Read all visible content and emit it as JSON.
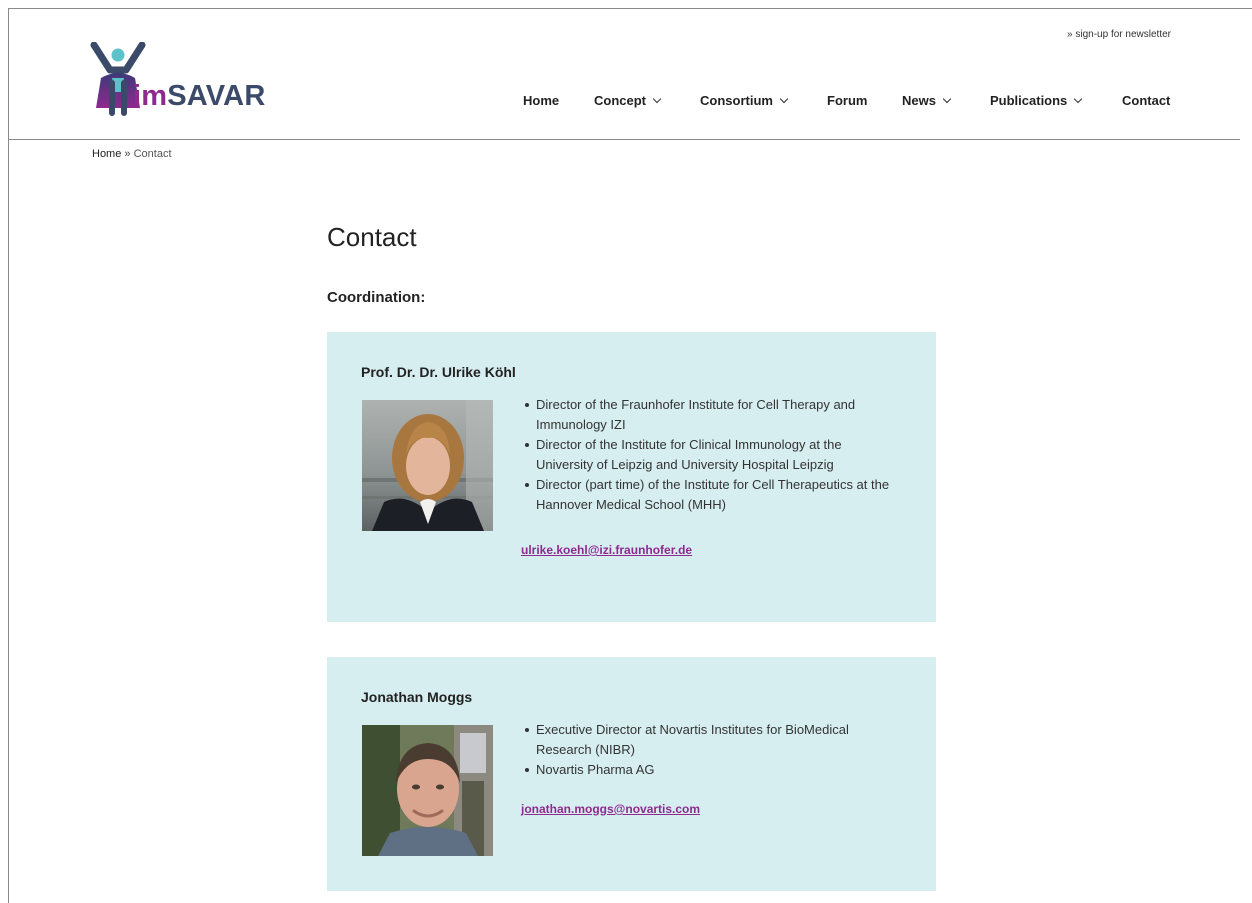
{
  "header": {
    "newsletter_link": "» sign-up for newsletter",
    "logo": {
      "prefix": "im",
      "suffix": "SAVAR"
    },
    "nav": [
      {
        "label": "Home",
        "has_dropdown": false
      },
      {
        "label": "Concept",
        "has_dropdown": true
      },
      {
        "label": "Consortium",
        "has_dropdown": true
      },
      {
        "label": "Forum",
        "has_dropdown": false
      },
      {
        "label": "News",
        "has_dropdown": true
      },
      {
        "label": "Publications",
        "has_dropdown": true
      },
      {
        "label": "Contact",
        "has_dropdown": false
      }
    ]
  },
  "breadcrumb": {
    "home": "Home",
    "separator": "»",
    "current": "Contact"
  },
  "page": {
    "title": "Contact",
    "section_heading": "Coordination:",
    "contacts": [
      {
        "name": "Prof. Dr. Dr. Ulrike Köhl",
        "bullets": [
          "Director of the Fraunhofer Institute for Cell Therapy and Immunology IZI",
          "Director of the Institute for Clinical Immunology at the University of Leipzig and University Hospital Leipzig",
          "Director (part time) of the Institute for Cell Therapeutics at the Hannover Medical School (MHH)"
        ],
        "email": "ulrike.koehl@izi.fraunhofer.de"
      },
      {
        "name": "Jonathan Moggs",
        "bullets": [
          "Executive Director at Novartis Institutes for BioMedical Research (NIBR)",
          "Novartis Pharma AG"
        ],
        "email": "jonathan.moggs@novartis.com"
      }
    ]
  },
  "colors": {
    "brand_purple": "#8e2a8e",
    "brand_navy": "#3a4a68",
    "logo_teal": "#5cc2c9",
    "card_background": "#d7eef1"
  }
}
